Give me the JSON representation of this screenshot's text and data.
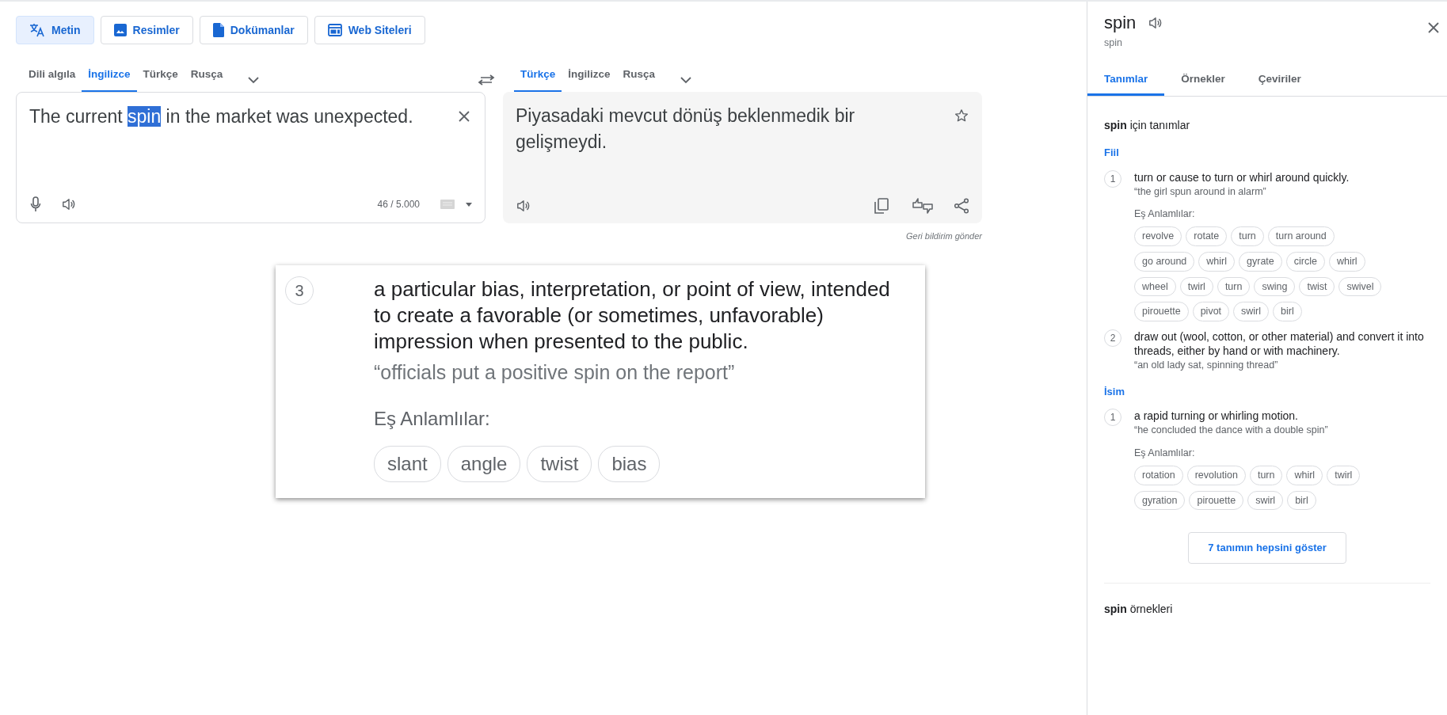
{
  "mode_tabs": [
    {
      "label": "Metin",
      "kind": "text",
      "selected": true
    },
    {
      "label": "Resimler",
      "kind": "images",
      "selected": false
    },
    {
      "label": "Dokümanlar",
      "kind": "documents",
      "selected": false
    },
    {
      "label": "Web Siteleri",
      "kind": "websites",
      "selected": false
    }
  ],
  "source_languages": [
    {
      "label": "Dili algıla",
      "selected": false
    },
    {
      "label": "İngilizce",
      "selected": true
    },
    {
      "label": "Türkçe",
      "selected": false
    },
    {
      "label": "Rusça",
      "selected": false
    }
  ],
  "target_languages": [
    {
      "label": "Türkçe",
      "selected": true
    },
    {
      "label": "İngilizce",
      "selected": false
    },
    {
      "label": "Rusça",
      "selected": false
    }
  ],
  "source": {
    "segments": [
      {
        "text": "The current ",
        "selected": false
      },
      {
        "text": "spin",
        "selected": true
      },
      {
        "text": " in the market was unexpected.",
        "selected": false
      }
    ],
    "char_count": "46 / 5.000"
  },
  "translation": {
    "text": "Piyasadaki mevcut dönüş beklenmedik bir gelişmeydi."
  },
  "feedback_link": "Geri bildirim gönder",
  "inset": {
    "number": "3",
    "definition": "a particular bias, interpretation, or point of view, intended to create a favorable (or sometimes, unfavorable) impression when presented to the public.",
    "example": "“officials put a positive spin on the report”",
    "synonyms_label": "Eş Anlamlılar:",
    "synonyms": [
      "slant",
      "angle",
      "twist",
      "bias"
    ]
  },
  "dictionary": {
    "word": "spin",
    "subtitle": "spin",
    "tabs": [
      {
        "label": "Tanımlar",
        "selected": true
      },
      {
        "label": "Örnekler",
        "selected": false
      },
      {
        "label": "Çeviriler",
        "selected": false
      }
    ],
    "heading": "**spin** için tanımlar",
    "groups": [
      {
        "pos": "Fiil",
        "senses": [
          {
            "number": "1",
            "definition": "turn or cause to turn or whirl around quickly.",
            "example": "“the girl spun around in alarm”",
            "synonyms_label": "Eş Anlamlılar:",
            "synonyms": [
              "revolve",
              "rotate",
              "turn",
              "turn around",
              "go around",
              "whirl",
              "gyrate",
              "circle",
              "whirl",
              "wheel",
              "twirl",
              "turn",
              "swing",
              "twist",
              "swivel",
              "pirouette",
              "pivot",
              "swirl",
              "birl"
            ]
          },
          {
            "number": "2",
            "definition": "draw out (wool, cotton, or other material) and convert it into threads, either by hand or with machinery.",
            "example": "“an old lady sat, spinning thread”"
          }
        ]
      },
      {
        "pos": "İsim",
        "senses": [
          {
            "number": "1",
            "definition": "a rapid turning or whirling motion.",
            "example": "“he concluded the dance with a double spin”",
            "synonyms_label": "Eş Anlamlılar:",
            "synonyms": [
              "rotation",
              "revolution",
              "turn",
              "whirl",
              "twirl",
              "gyration",
              "pirouette",
              "swirl",
              "birl"
            ]
          }
        ]
      }
    ],
    "show_all_button": "7 tanımın hepsini göster",
    "examples_heading": "**spin** örnekleri"
  }
}
